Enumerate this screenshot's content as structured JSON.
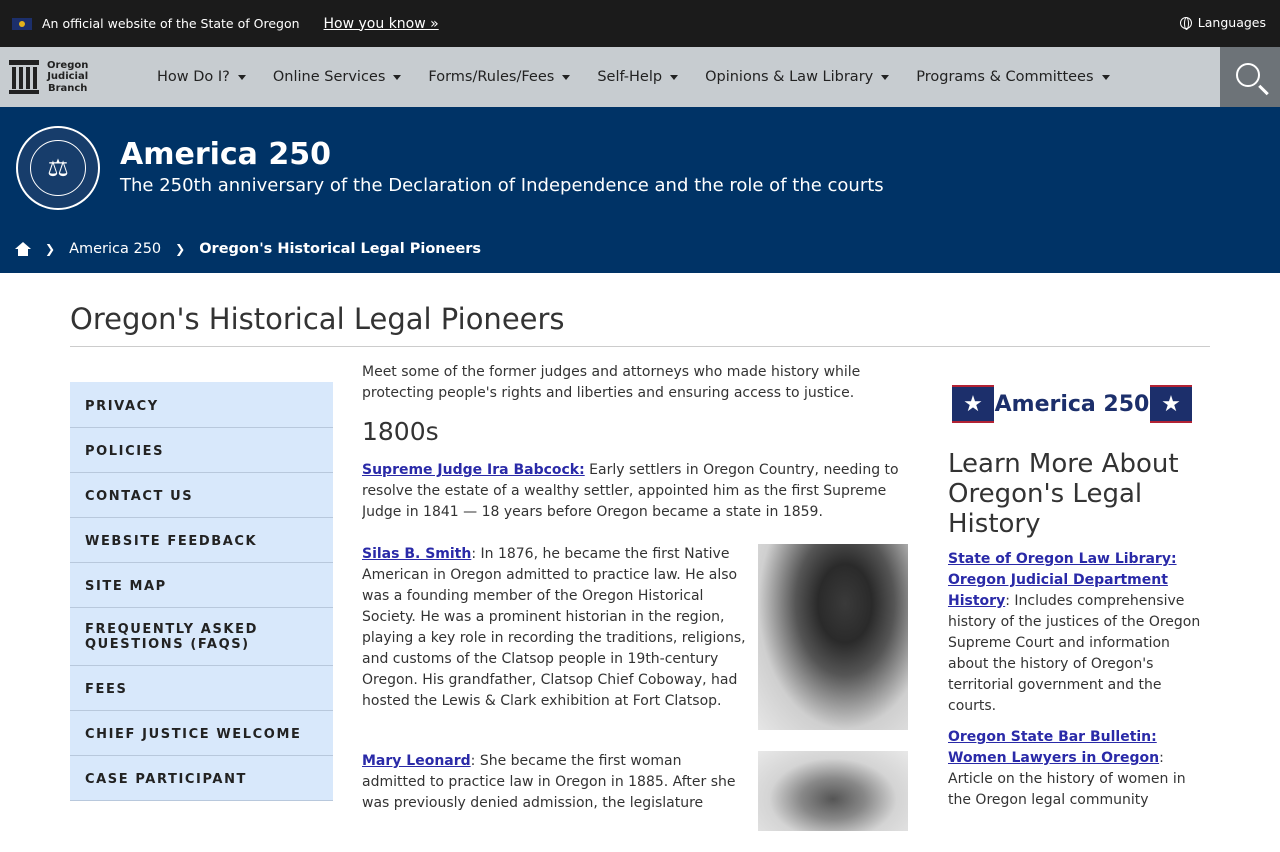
{
  "topbar": {
    "official": "An official website of the State of Oregon",
    "how_you_know": "How you know »",
    "languages": "Languages"
  },
  "nav": {
    "logo_line1": "Oregon",
    "logo_line2": "Judicial",
    "logo_line3": "Branch",
    "items": [
      "How Do I?",
      "Online Services",
      "Forms/Rules/Fees",
      "Self-Help",
      "Opinions & Law Library",
      "Programs & Committees"
    ]
  },
  "banner": {
    "title": "America 250",
    "subtitle": "The 250th anniversary of the Declaration of Independence and the role of the courts"
  },
  "breadcrumb": {
    "parent": "America 250",
    "current": "Oregon's Historical Legal Pioneers"
  },
  "page": {
    "title": "Oregon's Historical Legal Pioneers"
  },
  "sidebar": {
    "items": [
      "Privacy",
      "Policies",
      "Contact Us",
      "Website Feedback",
      "Site Map",
      "Frequently Asked Questions (FAQs)",
      "Fees",
      "Chief Justice Welcome",
      "Case Participant"
    ]
  },
  "main": {
    "intro": "Meet some of the former judges and attorneys who made history while protecting people's rights and liberties and ensuring access to justice.",
    "decade": "1800s",
    "entries": [
      {
        "name": "Supreme Judge Ira Babcock:",
        "text": " Early settlers in Oregon Country, needing to resolve the estate of a wealthy settler, appointed him as the first Supreme Judge in 1841 — 18 years before Oregon became a state in 1859."
      },
      {
        "name": "Silas B. Smith",
        "text": ": In 1876, he became the first Native American in Oregon admitted to practice law. He also was a founding member of the Oregon Historical Society. He was a prominent historian in the region, playing a key role in recording the traditions, religions, and customs of the Clatsop people in 19th-century Oregon. His grandfather, Clatsop Chief Coboway, had hosted the Lewis & Clark exhibition at Fort Clatsop."
      },
      {
        "name": "Mary Leonard",
        "text": ": She became the first woman admitted to practice law in Oregon in 1885. After she was previously denied admission, the legislature"
      }
    ]
  },
  "right": {
    "badge": "America 250",
    "heading": "Learn More About Oregon's Legal History",
    "resources": [
      {
        "link": "State of Oregon Law Library: Oregon Judicial Department History",
        "text": ": Includes comprehensive history of the justices of the Oregon Supreme Court and information about the history of Oregon's territorial government and the courts."
      },
      {
        "link": "Oregon State Bar Bulletin: Women Lawyers in Oregon",
        "text": ": Article on the history of women in the Oregon legal community"
      }
    ]
  }
}
